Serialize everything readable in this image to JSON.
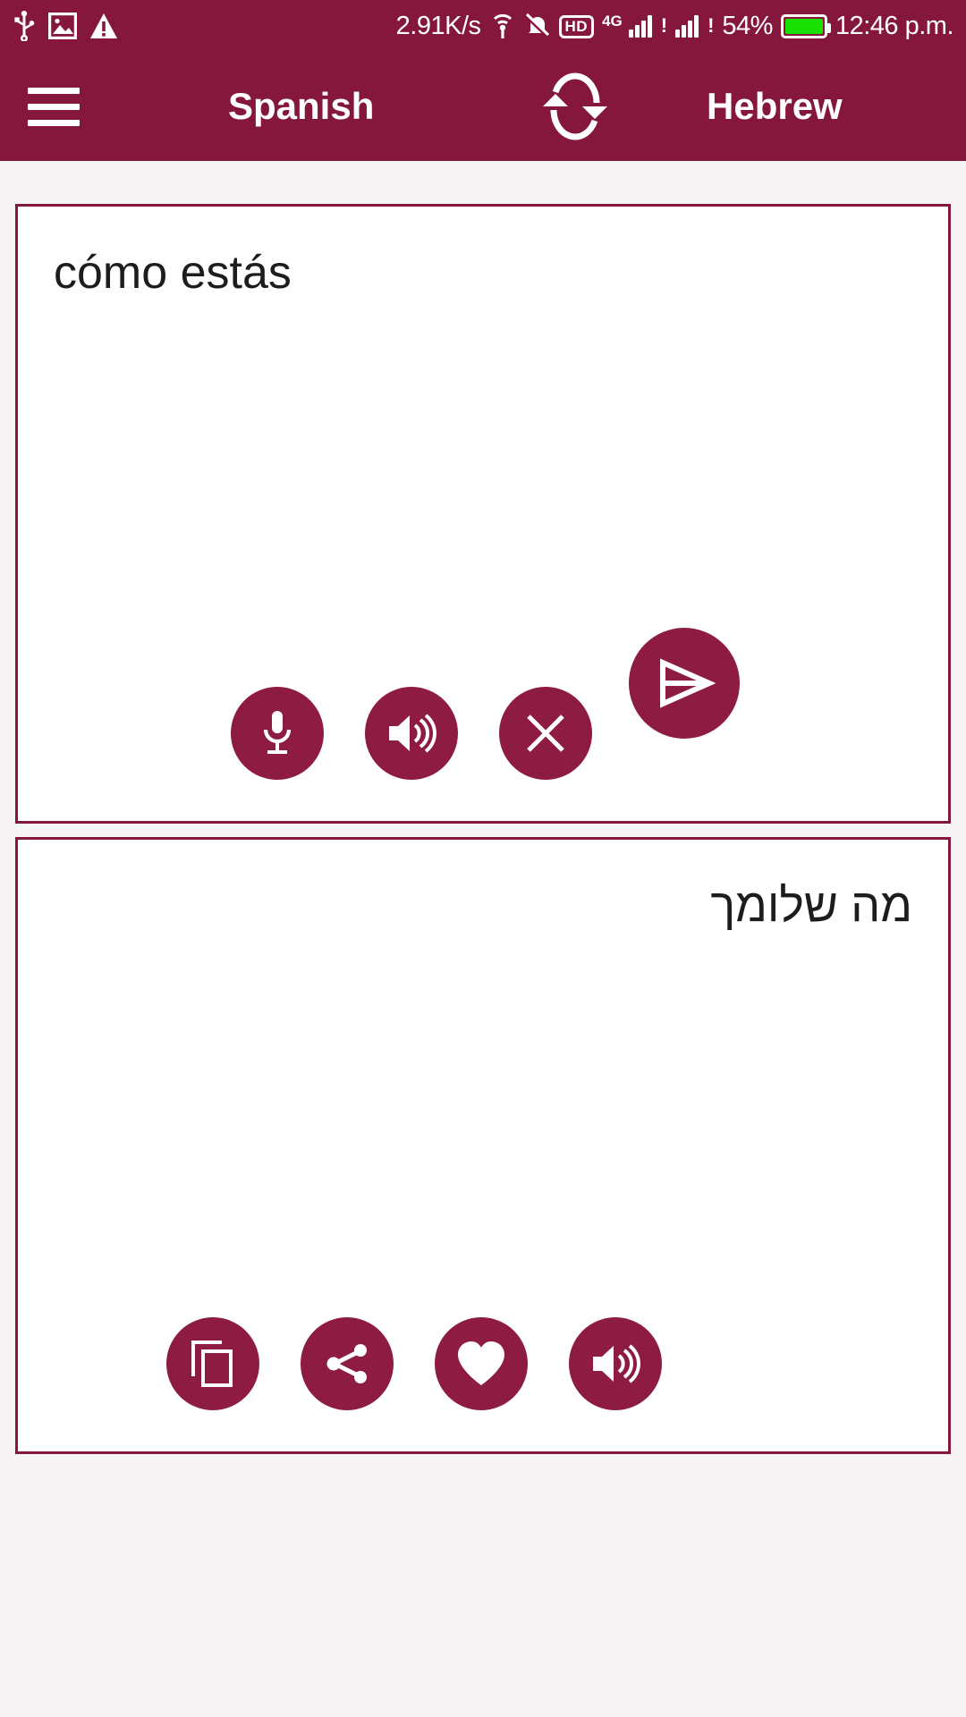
{
  "statusbar": {
    "left_icons": [
      "usb-icon",
      "image-icon",
      "warning-icon"
    ],
    "network_speed": "2.91K/s",
    "hotspot_icon": "hotspot-icon",
    "mute_icon": "bell-muted-icon",
    "hd_label": "HD",
    "network_type": "4G",
    "sim1_alert": "!",
    "sim2_alert": "!",
    "battery_percent": "54%",
    "battery_color": "#18e000",
    "clock": "12:46 p.m."
  },
  "appbar": {
    "menu_icon": "hamburger-menu-icon",
    "source_language": "Spanish",
    "swap_icon": "swap-languages-icon",
    "target_language": "Hebrew",
    "background_color": "#86173c"
  },
  "source_card": {
    "text": "cómo estás",
    "buttons": [
      {
        "name": "microphone-button",
        "icon": "microphone-icon"
      },
      {
        "name": "speak-source-button",
        "icon": "speaker-icon"
      },
      {
        "name": "clear-text-button",
        "icon": "close-icon"
      }
    ]
  },
  "translate_fab": {
    "name": "translate-send-button",
    "icon": "send-icon"
  },
  "target_card": {
    "text": "מה שלומך",
    "buttons": [
      {
        "name": "copy-button",
        "icon": "copy-icon"
      },
      {
        "name": "share-button",
        "icon": "share-icon"
      },
      {
        "name": "favorite-button",
        "icon": "heart-icon"
      },
      {
        "name": "speak-target-button",
        "icon": "speaker-icon"
      }
    ]
  },
  "theme": {
    "primary": "#86173c",
    "button": "#8e1b41",
    "card_background": "#ffffff",
    "page_background": "#f6f4f4",
    "text": "#1d1d1d"
  }
}
